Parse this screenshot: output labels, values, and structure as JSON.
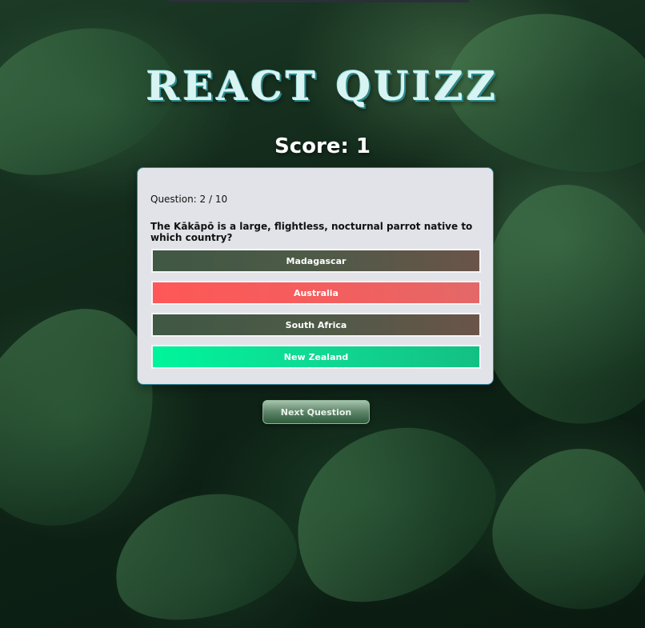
{
  "app": {
    "title": "REACT QUIZZ"
  },
  "score": {
    "label": "Score: 1"
  },
  "question": {
    "number_label": "Question: 2 / 10",
    "text": "The Kākāpō is a large, flightless, nocturnal parrot native to which country?",
    "answers": [
      {
        "label": "Madagascar",
        "state": "neutral"
      },
      {
        "label": "Australia",
        "state": "wrong"
      },
      {
        "label": "South Africa",
        "state": "neutral"
      },
      {
        "label": "New Zealand",
        "state": "correct"
      }
    ]
  },
  "controls": {
    "next_label": "Next Question"
  },
  "colors": {
    "card_background": "#e1e3e8",
    "card_border": "#2e8aa0",
    "wrong": "#ff5757",
    "correct": "#00f59b",
    "neutral": "#4e5a47",
    "title": "#d9f3f3"
  }
}
